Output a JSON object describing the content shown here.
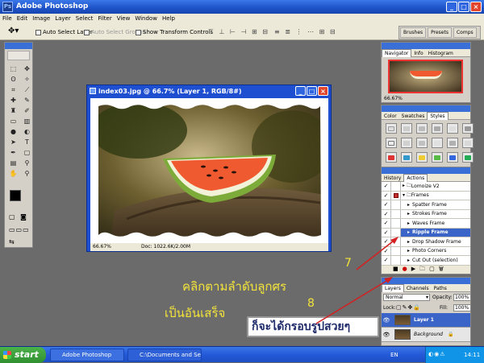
{
  "app": {
    "title": "Adobe Photoshop",
    "logo_text": "Ps"
  },
  "menu": [
    "File",
    "Edit",
    "Image",
    "Layer",
    "Select",
    "Filter",
    "View",
    "Window",
    "Help"
  ],
  "options": {
    "auto_select_layer": "Auto Select Layer",
    "auto_select_groups": "Auto Select Groups",
    "show_transform": "Show Transform Controls"
  },
  "dock_tabs": [
    "Brushes",
    "Presets",
    "Comps"
  ],
  "document": {
    "title": "index03.jpg @ 66.7% (Layer 1, RGB/8#)",
    "zoom": "66.67%",
    "doc_size": "Doc: 1022.6K/2.00M"
  },
  "navigator": {
    "tabs": [
      "Navigator",
      "Info",
      "Histogram"
    ],
    "zoom": "66.67%"
  },
  "styles_panel": {
    "tabs": [
      "Color",
      "Swatches",
      "Styles"
    ]
  },
  "actions_panel": {
    "tabs": [
      "History",
      "Actions"
    ],
    "rows": [
      {
        "label": "Lomoize V2",
        "selected": false
      },
      {
        "label": "Frames",
        "selected": false
      },
      {
        "label": "Spatter Frame",
        "selected": false
      },
      {
        "label": "Strokes Frame",
        "selected": false
      },
      {
        "label": "Waves Frame",
        "selected": false
      },
      {
        "label": "Ripple Frame",
        "selected": true
      },
      {
        "label": "Drop Shadow Frame",
        "selected": false
      },
      {
        "label": "Photo Corners",
        "selected": false
      },
      {
        "label": "Cut Out (selection)",
        "selected": false
      }
    ]
  },
  "layers_panel": {
    "tabs": [
      "Layers",
      "Channels",
      "Paths"
    ],
    "blend_mode": "Normal",
    "opacity_label": "Opacity:",
    "opacity": "100%",
    "lock_label": "Lock:",
    "fill_label": "Fill:",
    "fill": "100%",
    "layers": [
      "Layer 1",
      "Background"
    ]
  },
  "annotations": {
    "instruction_1": "คลิกตามลำดับลูกศร",
    "instruction_2": "เป็นอันเสร็จ",
    "step_7": "7",
    "step_8": "8",
    "result_text": "ก็จะได้กรอบรูปสวยๆ",
    "arrow_color": "#d42020",
    "text_color": "#f3e43a"
  },
  "taskbar": {
    "start": "start",
    "buttons": [
      "Adobe Photoshop",
      "C:\\Documents and Se..."
    ],
    "tray_lang": "EN",
    "clock": "14:11"
  }
}
